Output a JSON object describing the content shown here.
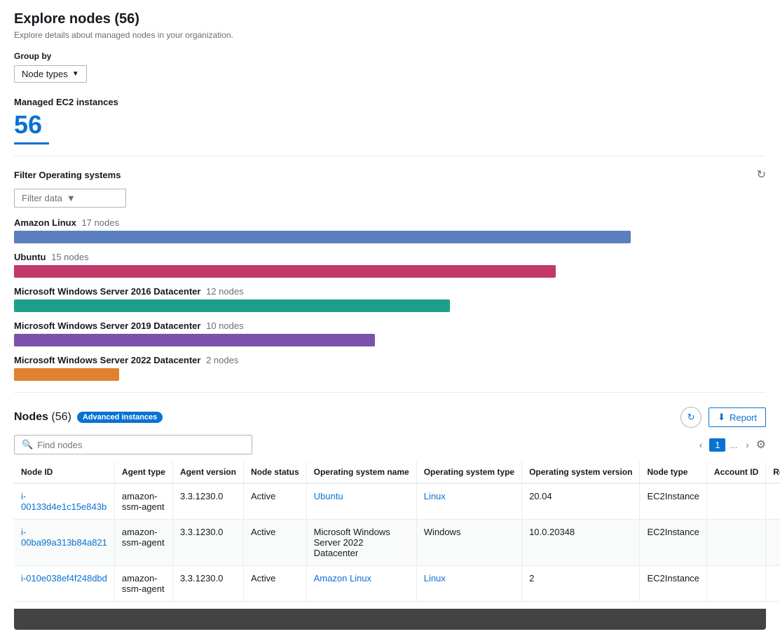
{
  "page": {
    "title": "Explore nodes",
    "title_count": "(56)",
    "subtitle": "Explore details about managed nodes in your organization."
  },
  "group_by": {
    "label": "Group by",
    "value": "Node types",
    "dropdown_icon": "▼"
  },
  "managed_ec2": {
    "label": "Managed EC2 instances",
    "count": "56"
  },
  "filter": {
    "label": "Filter Operating systems",
    "placeholder": "Filter data",
    "dropdown_icon": "▼"
  },
  "os_bars": [
    {
      "name": "Amazon Linux",
      "count": "17 nodes",
      "color": "#5a7fbf",
      "width_pct": 82
    },
    {
      "name": "Ubuntu",
      "count": "15 nodes",
      "color": "#c0396a",
      "width_pct": 72
    },
    {
      "name": "Microsoft Windows Server 2016 Datacenter",
      "count": "12 nodes",
      "color": "#1e9e8a",
      "width_pct": 58
    },
    {
      "name": "Microsoft Windows Server 2019 Datacenter",
      "count": "10 nodes",
      "color": "#7b52ab",
      "width_pct": 48
    },
    {
      "name": "Microsoft Windows Server 2022 Datacenter",
      "count": "2 nodes",
      "color": "#e08030",
      "width_pct": 14
    }
  ],
  "nodes_section": {
    "title": "Nodes",
    "count": "(56)",
    "badge": "Advanced instances",
    "refresh_title": "Refresh",
    "report_label": "Report",
    "report_icon": "⬇",
    "search_placeholder": "Find nodes",
    "pagination": {
      "prev": "‹",
      "page": "1",
      "dots": "...",
      "next": "›"
    }
  },
  "table": {
    "columns": [
      "Node ID",
      "Agent type",
      "Agent version",
      "Node status",
      "Operating system name",
      "Operating system type",
      "Operating system version",
      "Node type",
      "Account ID",
      "Region"
    ],
    "rows": [
      {
        "node_id": "i-00133d4e1c15e843b",
        "agent_type": "amazon-ssm-agent",
        "agent_version": "3.3.1230.0",
        "node_status": "Active",
        "os_name": "Ubuntu",
        "os_type": "Linux",
        "os_version": "20.04",
        "node_type": "EC2Instance",
        "account_id": "",
        "region": ""
      },
      {
        "node_id": "i-00ba99a313b84a821",
        "agent_type": "amazon-ssm-agent",
        "agent_version": "3.3.1230.0",
        "node_status": "Active",
        "os_name": "Microsoft Windows Server 2022 Datacenter",
        "os_type": "Windows",
        "os_version": "10.0.20348",
        "node_type": "EC2Instance",
        "account_id": "",
        "region": ""
      },
      {
        "node_id": "i-010e038ef4f248dbd",
        "agent_type": "amazon-ssm-agent",
        "agent_version": "3.3.1230.0",
        "node_status": "Active",
        "os_name": "Amazon Linux",
        "os_type": "Linux",
        "os_version": "2",
        "node_type": "EC2Instance",
        "account_id": "",
        "region": ""
      }
    ]
  }
}
